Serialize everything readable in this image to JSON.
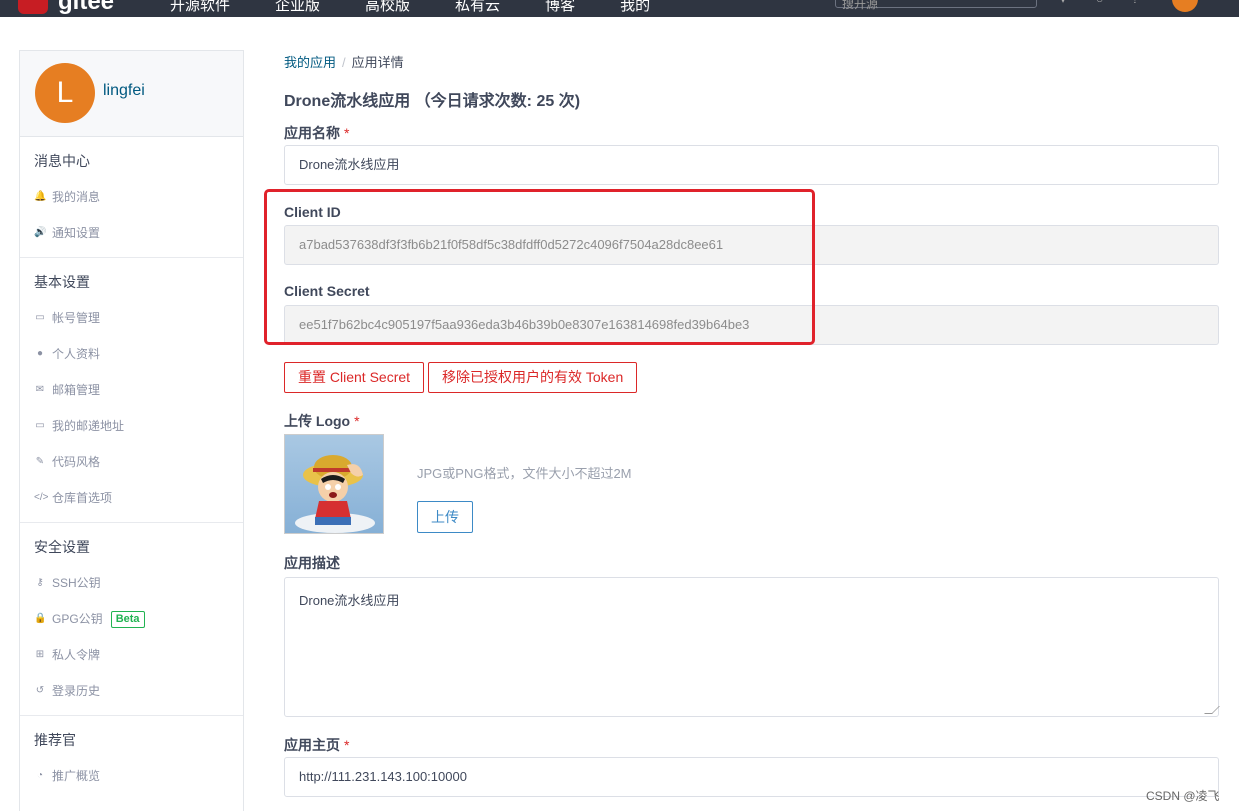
{
  "topbar": {
    "logo_text": "gitee",
    "nav": [
      "开源软件",
      "企业版",
      "高校版",
      "私有云",
      "博客",
      "我的"
    ],
    "search_placeholder": "搜开源"
  },
  "sidebar": {
    "avatar_letter": "L",
    "username": "lingfei",
    "sections": [
      {
        "title": "消息中心",
        "items": [
          {
            "icon": "bell-icon",
            "glyph": "🔔",
            "label": "我的消息"
          },
          {
            "icon": "speaker-icon",
            "glyph": "🔊",
            "label": "通知设置"
          }
        ]
      },
      {
        "title": "基本设置",
        "items": [
          {
            "icon": "id-card-icon",
            "glyph": "▭",
            "label": "帐号管理"
          },
          {
            "icon": "user-icon",
            "glyph": "●",
            "label": "个人资料"
          },
          {
            "icon": "mail-icon",
            "glyph": "✉",
            "label": "邮箱管理"
          },
          {
            "icon": "address-card-icon",
            "glyph": "▭",
            "label": "我的邮递地址"
          },
          {
            "icon": "brush-icon",
            "glyph": "✎",
            "label": "代码风格"
          },
          {
            "icon": "code-icon",
            "glyph": "</>",
            "label": "仓库首选项"
          }
        ]
      },
      {
        "title": "安全设置",
        "items": [
          {
            "icon": "key-icon",
            "glyph": "⚷",
            "label": "SSH公钥"
          },
          {
            "icon": "lock-icon",
            "glyph": "🔒",
            "label": "GPG公钥",
            "badge": "Beta"
          },
          {
            "icon": "token-icon",
            "glyph": "⊞",
            "label": "私人令牌"
          },
          {
            "icon": "history-icon",
            "glyph": "↺",
            "label": "登录历史"
          }
        ]
      },
      {
        "title": "推荐官",
        "items": [
          {
            "icon": "chart-icon",
            "glyph": "◔",
            "label": "推广概览"
          }
        ]
      }
    ]
  },
  "main": {
    "breadcrumb": {
      "link": "我的应用",
      "separator": "/",
      "current": "应用详情"
    },
    "title": "Drone流水线应用 （今日请求次数: 25 次)",
    "app_name_label": "应用名称",
    "app_name_value": "Drone流水线应用",
    "client_id_label": "Client ID",
    "client_id_value": "a7bad537638df3f3fb6b21f0f58df5c38dfdff0d5272c4096f7504a28dc8ee61",
    "client_secret_label": "Client Secret",
    "client_secret_value": "ee51f7b62bc4c905197f5aa936eda3b46b39b0e8307e163814698fed39b64be3",
    "reset_secret_button": "重置 Client Secret",
    "remove_tokens_button": "移除已授权用户的有效 Token",
    "logo_label": "上传 Logo",
    "upload_hint": "JPG或PNG格式，文件大小不超过2M",
    "upload_button": "上传",
    "description_label": "应用描述",
    "description_value": "Drone流水线应用",
    "homepage_label": "应用主页",
    "homepage_value": "http://111.231.143.100:10000",
    "required_mark": "*"
  },
  "watermark": "CSDN @凌飞",
  "colors": {
    "accent_red": "#db2828",
    "link_blue": "#005980",
    "avatar_orange": "#e67e22",
    "beta_green": "#21b351"
  }
}
